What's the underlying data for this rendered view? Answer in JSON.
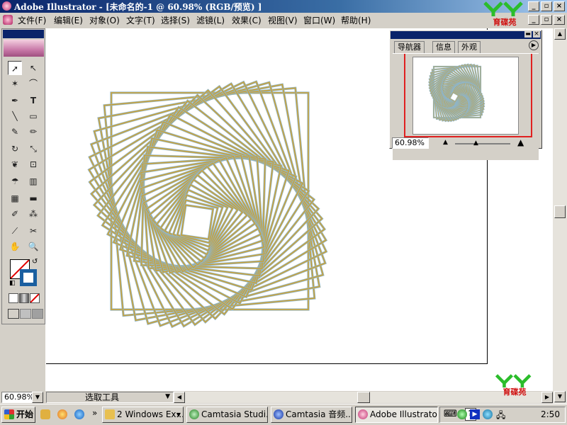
{
  "window": {
    "title": "Adobe Illustrator - [未命名的-1 @ 60.98% (RGB/预览) ]"
  },
  "menubar": {
    "items": [
      "文件(F)",
      "编辑(E)",
      "对象(O)",
      "文字(T)",
      "选择(S)",
      "滤镜(L)",
      "效果(C)",
      "视图(V)",
      "窗口(W)",
      "帮助(H)"
    ]
  },
  "logo": {
    "text": "育碟苑"
  },
  "navigator": {
    "tabs": [
      "导航器",
      "信息",
      "外观"
    ],
    "zoom": "60.98%"
  },
  "statusbar": {
    "zoom": "60.98%",
    "current_tool": "选取工具"
  },
  "taskbar": {
    "start_label": "开始",
    "tasks": [
      "2 Windows Ex...",
      "Camtasia Studi...",
      "Camtasia 音频...",
      "Adobe Illustrato..."
    ],
    "clock": "2:50"
  },
  "colors": {
    "titlebar": "#0a246a",
    "stroke_outer": "#8fb5c8",
    "stroke_inner": "#c9a23a"
  }
}
